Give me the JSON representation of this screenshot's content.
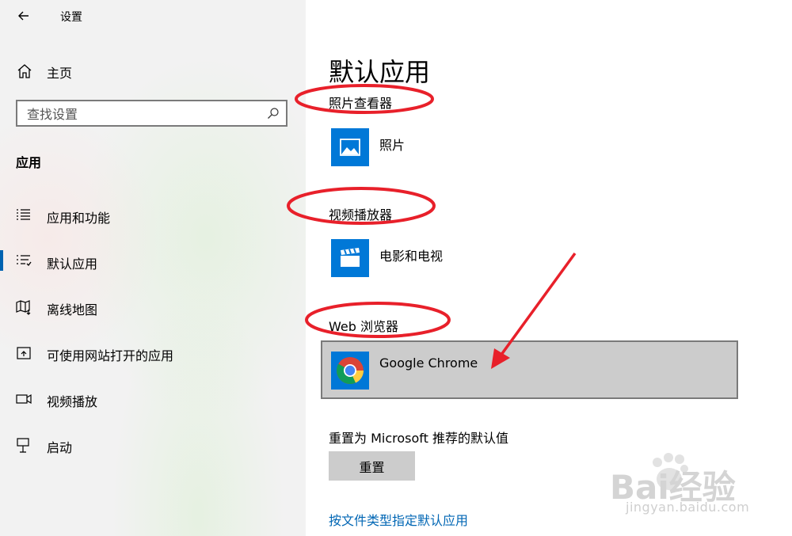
{
  "window": {
    "title": "设置"
  },
  "sidebar": {
    "home_label": "主页",
    "search_placeholder": "查找设置",
    "section_title": "应用",
    "items": [
      {
        "label": "应用和功能",
        "icon": "list-icon",
        "active": false
      },
      {
        "label": "默认应用",
        "icon": "default-apps-icon",
        "active": true
      },
      {
        "label": "离线地图",
        "icon": "map-icon",
        "active": false
      },
      {
        "label": "可使用网站打开的应用",
        "icon": "open-in-icon",
        "active": false
      },
      {
        "label": "视频播放",
        "icon": "video-icon",
        "active": false
      },
      {
        "label": "启动",
        "icon": "startup-icon",
        "active": false
      }
    ],
    "accent_color": "#0063b1"
  },
  "main": {
    "page_title": "默认应用",
    "groups": [
      {
        "title": "照片查看器",
        "app": "照片",
        "icon": "photos-icon"
      },
      {
        "title": "视频播放器",
        "app": "电影和电视",
        "icon": "movies-tv-icon"
      },
      {
        "title": "Web 浏览器",
        "app": "Google Chrome",
        "icon": "chrome-icon"
      }
    ],
    "reset_label": "重置为 Microsoft 推荐的默认值",
    "reset_button": "重置",
    "link_text": "按文件类型指定默认应用",
    "tile_color": "#0078d7",
    "link_color": "#0066b4"
  },
  "annotations": {
    "highlight_color": "#e8202a"
  },
  "watermark": {
    "brand": "Bai经验",
    "url": "jingyan.baidu.com"
  }
}
